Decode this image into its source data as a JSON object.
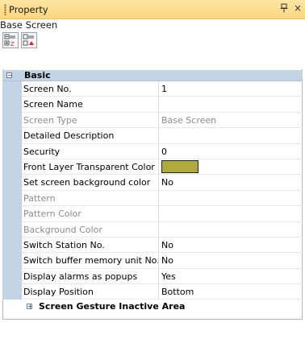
{
  "panel": {
    "title": "Property",
    "pin_glyph": "↑",
    "close_glyph": "×"
  },
  "object_name": "Base Screen",
  "toolbar": {
    "buttons": [
      {
        "icon": "categorized-view-icon"
      },
      {
        "icon": "alphabetical-sort-icon"
      }
    ]
  },
  "category": {
    "toggle": "−",
    "label": "Basic"
  },
  "properties": [
    {
      "name": "Screen No.",
      "value": "1",
      "disabled": false
    },
    {
      "name": "Screen Name",
      "value": "",
      "disabled": false
    },
    {
      "name": "Screen Type",
      "value": "Base Screen",
      "disabled": true
    },
    {
      "name": "Detailed Description",
      "value": "",
      "disabled": false
    },
    {
      "name": "Security",
      "value": "0",
      "disabled": false
    },
    {
      "name": "Front Layer Transparent Color",
      "value": "",
      "swatch": "#b0aa3c",
      "disabled": false
    },
    {
      "name": "Set screen background color",
      "value": "No",
      "disabled": false
    },
    {
      "name": "Pattern",
      "value": "",
      "disabled": true
    },
    {
      "name": "Pattern Color",
      "value": "",
      "disabled": true
    },
    {
      "name": "Background Color",
      "value": "",
      "disabled": true
    },
    {
      "name": "Switch Station No.",
      "value": "No",
      "disabled": false
    },
    {
      "name": "Switch buffer memory unit No.",
      "value": "No",
      "disabled": false
    },
    {
      "name": "Display alarms as popups",
      "value": "Yes",
      "disabled": false
    },
    {
      "name": "Display Position",
      "value": "Bottom",
      "disabled": false
    }
  ],
  "subcategory": {
    "toggle": "+",
    "label": "Screen Gesture Inactive Area"
  }
}
